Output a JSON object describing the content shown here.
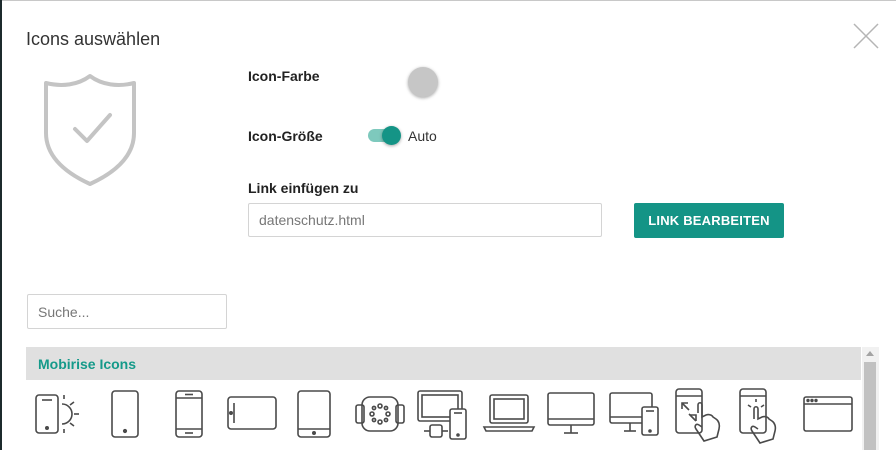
{
  "dialog": {
    "title": "Icons auswählen"
  },
  "settings": {
    "color_label": "Icon-Farbe",
    "color_value": "#c6c6c6",
    "size_label": "Icon-Größe",
    "size_toggle_on": true,
    "size_value": "Auto",
    "link_label": "Link einfügen zu",
    "link_placeholder": "datenschutz.html",
    "edit_link_button": "LINK BEARBEITEN"
  },
  "search": {
    "placeholder": "Suche..."
  },
  "library": {
    "name": "Mobirise Icons",
    "icons": [
      "phone-brightness-icon",
      "smartphone-icon",
      "phone-buttons-icon",
      "tablet-landscape-icon",
      "tablet-portrait-icon",
      "smartwatch-icon",
      "devices-icon",
      "laptop-icon",
      "desktop-icon",
      "desktop-phone-icon",
      "phone-pinch-icon",
      "phone-tap-icon",
      "browser-window-icon"
    ]
  },
  "colors": {
    "accent": "#149486",
    "accent_light": "#7ec9bd",
    "header_text": "#159a8a",
    "icon_stroke": "#4a4a4a"
  }
}
